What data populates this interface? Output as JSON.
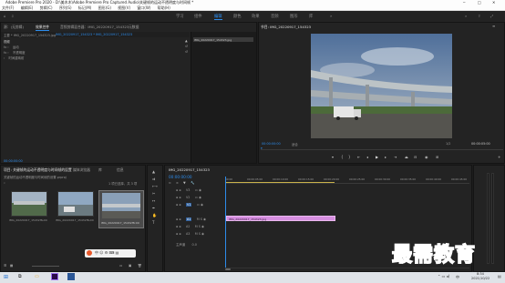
{
  "window": {
    "title": "Adobe Premiere Pro 2020 - D:\\美木木\\Adobe Premiere Pro Captured Audio\\关键帧的运动不透明度与时间帧 *",
    "minimize": "─",
    "maximize": "□",
    "close": "✕"
  },
  "menu": [
    "文件(F)",
    "编辑(E)",
    "剪辑(C)",
    "序列(S)",
    "标记(M)",
    "图形(G)",
    "视图(V)",
    "窗口(W)",
    "帮助(H)"
  ],
  "workspaces": [
    "学习",
    "组件",
    "编辑",
    "颜色",
    "效果",
    "音频",
    "图形",
    "库"
  ],
  "active_workspace": "编辑",
  "source_panel": {
    "tabs": [
      "源：(无剪辑)",
      "效果控件",
      "音频剪辑混合器：IMG_20220917_154323",
      "元数据"
    ],
    "active_tab": "效果控件",
    "subheader_left": "主要 * IMG_20220917_154323.jpg",
    "subheader_right": "IMG_20220917_154323 * IMG_20220917_154323",
    "section_label": "视频",
    "rows": [
      "运动",
      "不透明度",
      "时间重映射"
    ],
    "clip_name": "IMG_20220917_154323.jpg",
    "timecode": "00:00:00:00"
  },
  "program_monitor": {
    "title": "节目: IMG_20220917_154323",
    "timecode_left": "00:00:00:00",
    "fit": "适合",
    "ratio": "1/2",
    "timecode_right": "00:00:05:00"
  },
  "project_panel": {
    "tabs": [
      "项目: 关键帧的运动不透明度与时间帧的设置",
      "媒体浏览器",
      "库",
      "信息"
    ],
    "path": "关键帧的运动不透明度与时间帧的设置.prproj",
    "count": "1 项已选择，共 3 项",
    "items": [
      {
        "name": "IMG_20220917_154323...",
        "duration": "5:00"
      },
      {
        "name": "IMG_20220917_154323...",
        "duration": "5:00"
      },
      {
        "name": "IMG_20220917_154323",
        "duration": "5:00"
      }
    ]
  },
  "timeline": {
    "tab": "IMG_20220917_154323",
    "timecode": "00:00:00:00",
    "ruler": [
      "00:00",
      "00:00:05:00",
      "00:00:10:00",
      "00:00:15:00",
      "00:00:20:00",
      "00:00:25:00",
      "00:00:30:00",
      "00:00:35:00",
      "00:00:40:00",
      "00:00:45:00"
    ],
    "video_tracks": [
      "V3",
      "V2",
      "V1"
    ],
    "audio_tracks": [
      "A1",
      "A2",
      "A3"
    ],
    "master": "主声道",
    "master_value": "0.0",
    "clip_label": "IMG_20220917_154323.jpg"
  },
  "taskbar": {
    "time": "8:34",
    "date": "2021/10/22",
    "lang": "中"
  },
  "watermark": "最需教育"
}
